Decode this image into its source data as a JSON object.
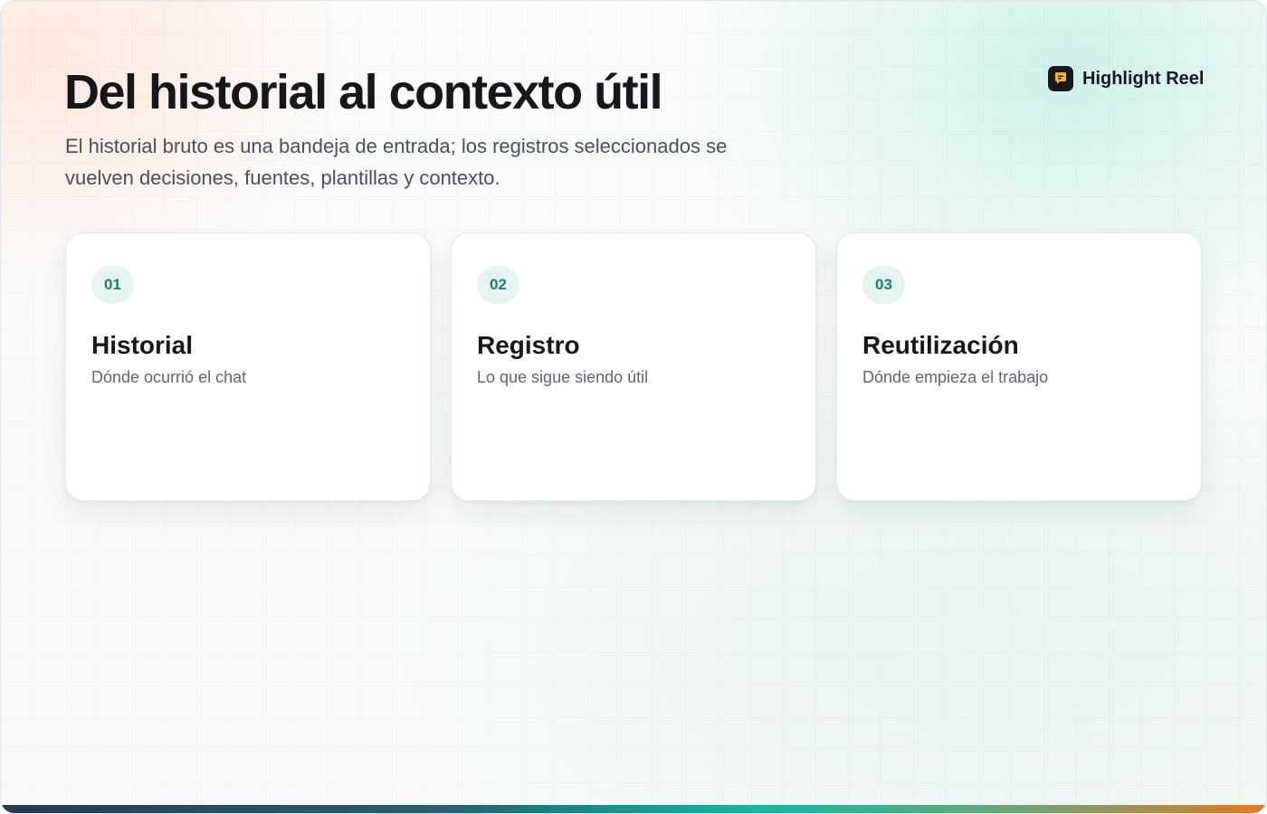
{
  "header": {
    "title": "Del historial al contexto útil",
    "subtitle": "El historial bruto es una bandeja de entrada; los registros seleccionados se vuelven decisiones, fuentes, plantillas y contexto."
  },
  "brand": {
    "name": "Highlight Reel",
    "icon": "chat-bubble-icon",
    "logo_color": "#17191d",
    "icon_color": "#f4b62a"
  },
  "cards": [
    {
      "step": "01",
      "title": "Historial",
      "description": "Dónde ocurrió el chat"
    },
    {
      "step": "02",
      "title": "Registro",
      "description": "Lo que sigue siendo útil"
    },
    {
      "step": "03",
      "title": "Reutilización",
      "description": "Dónde empieza el trabajo"
    }
  ],
  "colors": {
    "badge_background": "#e6f4f1",
    "badge_text": "#1e7e70",
    "bar_gradient": [
      "#2b3a4a",
      "#23626e",
      "#1fb3a0",
      "#6aa579",
      "#e07b2d"
    ]
  }
}
